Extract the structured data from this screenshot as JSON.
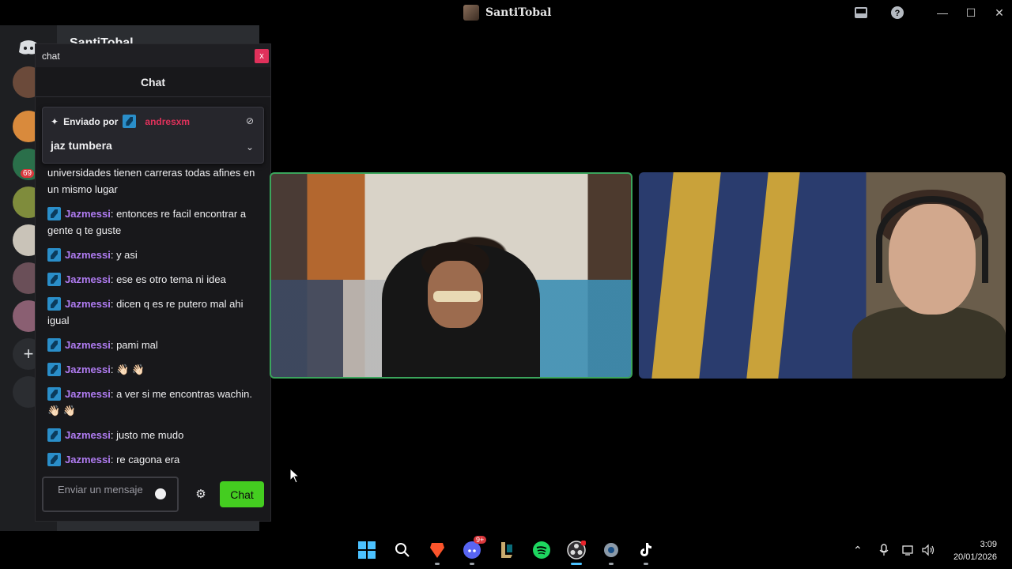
{
  "titlebar": {
    "title": "SantiTobal",
    "window_controls": {
      "minimize": "—",
      "maximize": "☐",
      "close": "✕"
    },
    "icons": [
      "inbox-icon",
      "help-icon"
    ]
  },
  "discord": {
    "behind_title": "SantiTobal",
    "server_badge": "69"
  },
  "chat_window": {
    "window_title": "chat",
    "close_label": "x",
    "header": "Chat",
    "pinned": {
      "sent_by_label": "Enviado por",
      "user": "andresxm",
      "message": "jaz tumbera"
    },
    "messages": [
      {
        "user": "",
        "text": "universidades tienen carreras todas afines en un mismo lugar"
      },
      {
        "user": "Jazmessi",
        "text": "entonces re facil encontrar a gente q te guste"
      },
      {
        "user": "Jazmessi",
        "text": "y asi"
      },
      {
        "user": "Jazmessi",
        "text": "ese es otro tema ni idea"
      },
      {
        "user": "Jazmessi",
        "text": "dicen q es re putero mal ahi igual"
      },
      {
        "user": "Jazmessi",
        "text": "pami mal"
      },
      {
        "user": "Jazmessi",
        "text": "👋🏻 👋🏻"
      },
      {
        "user": "Jazmessi",
        "text": "a ver si me encontras wachin. 👋🏻 👋🏻"
      },
      {
        "user": "Jazmessi",
        "text": "justo me mudo"
      },
      {
        "user": "Jazmessi",
        "text": "re cagona era"
      }
    ],
    "input_placeholder": "Enviar un mensaje",
    "send_label": "Chat"
  },
  "taskbar": {
    "discord_badge": "9+",
    "time": "3:09",
    "date": "20/01/2026"
  }
}
